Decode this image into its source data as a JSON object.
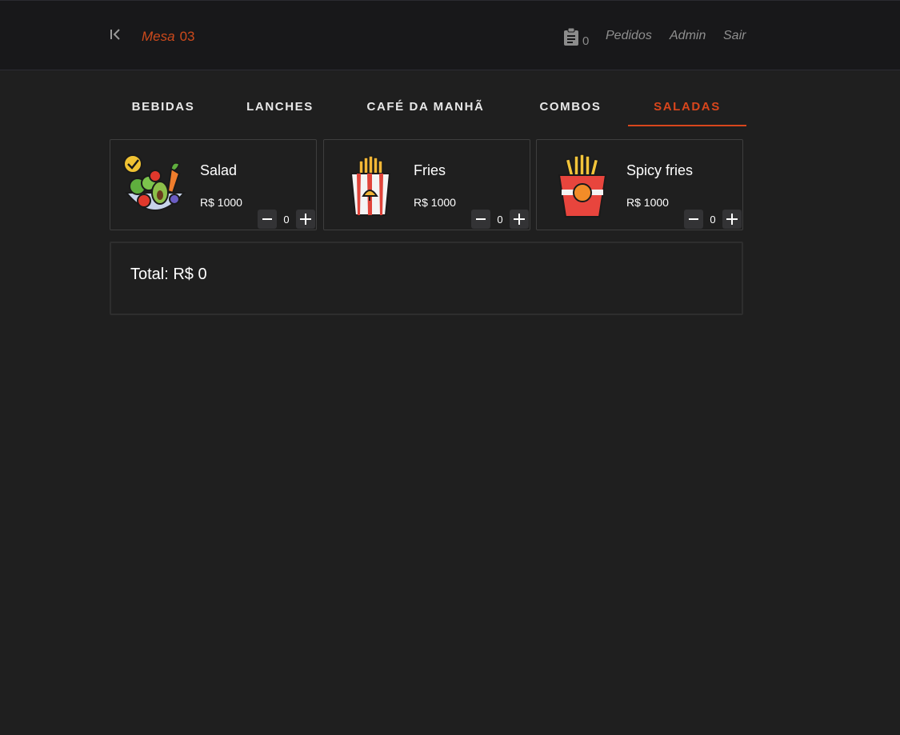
{
  "header": {
    "mesa_label": "Mesa",
    "mesa_number": "03",
    "orders_count": "0",
    "nav": [
      "Pedidos",
      "Admin",
      "Sair"
    ]
  },
  "tabs": [
    {
      "label": "BEBIDAS",
      "active": false
    },
    {
      "label": "LANCHES",
      "active": false
    },
    {
      "label": "CAFÉ DA MANHÃ",
      "active": false
    },
    {
      "label": "COMBOS",
      "active": false
    },
    {
      "label": "SALADAS",
      "active": true
    }
  ],
  "products": [
    {
      "name": "Salad",
      "price": "R$ 1000",
      "quantity": "0",
      "icon": "salad-bowl-icon"
    },
    {
      "name": "Fries",
      "price": "R$ 1000",
      "quantity": "0",
      "icon": "fries-icon"
    },
    {
      "name": "Spicy fries",
      "price": "R$ 1000",
      "quantity": "0",
      "icon": "spicy-fries-icon"
    }
  ],
  "total": {
    "text": "Total: R$ 0"
  },
  "colors": {
    "accent": "#d9461c",
    "background": "#1f1f1f",
    "header_bg": "#18181a"
  }
}
